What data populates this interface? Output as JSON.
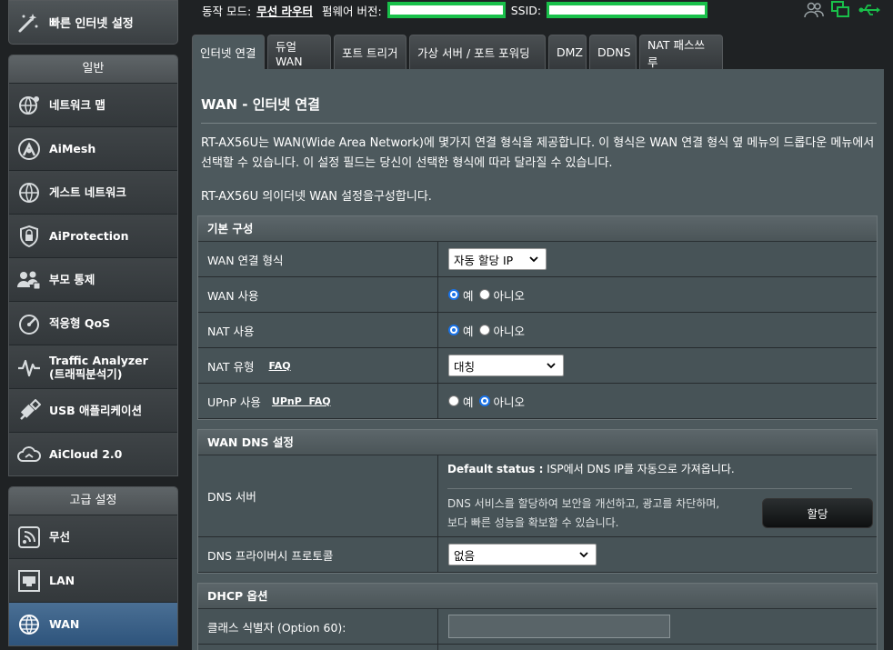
{
  "quick_setup": {
    "label": "빠른 인터넷 설정"
  },
  "sidebar": {
    "general_title": "일반",
    "general_items": [
      {
        "label": "네트워크 맵",
        "icon": "globe-network-icon"
      },
      {
        "label": "AiMesh",
        "icon": "aimesh-icon"
      },
      {
        "label": "게스트 네트워크",
        "icon": "guest-network-icon"
      },
      {
        "label": "AiProtection",
        "icon": "shield-icon"
      },
      {
        "label": "부모 통제",
        "icon": "parental-control-icon"
      },
      {
        "label": "적응형 QoS",
        "icon": "gauge-icon"
      },
      {
        "label": "Traffic Analyzer",
        "label2": "(트래픽분석기)",
        "icon": "pulse-icon"
      },
      {
        "label": "USB 애플리케이션",
        "icon": "usb-icon"
      },
      {
        "label": "AiCloud 2.0",
        "icon": "cloud-icon"
      }
    ],
    "advanced_title": "고급 설정",
    "advanced_items": [
      {
        "label": "무선",
        "icon": "wireless-icon"
      },
      {
        "label": "LAN",
        "icon": "lan-icon"
      },
      {
        "label": "WAN",
        "icon": "globe-icon",
        "active": true
      }
    ]
  },
  "topbar": {
    "mode_label": "동작 모드:",
    "mode_value": "무선 라우터",
    "firmware_label": "펌웨어 버전:",
    "ssid_label": "SSID:"
  },
  "tabs": [
    "인터넷 연결",
    "듀얼 WAN",
    "포트 트리거",
    "가상 서버 / 포트 포워딩",
    "DMZ",
    "DDNS",
    "NAT 패스쓰루"
  ],
  "main": {
    "title": "WAN - 인터넷 연결",
    "description": "RT-AX56U는 WAN(Wide Area Network)에 몇가지 연결 형식을 제공합니다. 이 형식은 WAN 연결 형식 옆 메뉴의 드롭다운 메뉴에서 선택할 수 있습니다. 이 설정 필드는 당신이 선택한 형식에 따라 달라질 수 있습니다.",
    "description2": "RT-AX56U 의이더넷 WAN 설정을구성합니다."
  },
  "basic": {
    "header": "기본 구성",
    "wan_type_label": "WAN 연결 형식",
    "wan_type_value": "자동 할당 IP",
    "wan_enable_label": "WAN 사용",
    "nat_enable_label": "NAT 사용",
    "nat_type_label": "NAT 유형",
    "nat_type_faq": "FAQ",
    "nat_type_value": "대칭",
    "upnp_label": "UPnP 사용",
    "upnp_faq": "UPnP  FAQ",
    "yes": "예",
    "no": "아니오"
  },
  "dns": {
    "header": "WAN DNS 설정",
    "server_label": "DNS 서버",
    "status_bold": "Default status :",
    "status_text": " ISP에서 DNS IP를 자동으로 가져옵니다.",
    "help_line1": "DNS 서비스를 할당하여 보안을 개선하고, 광고를 차단하며,",
    "help_line2": "보다 빠른 성능을 확보할 수 있습니다.",
    "assign_button": "할당",
    "privacy_label": "DNS 프라이버시 프로토콜",
    "privacy_value": "없음"
  },
  "dhcp": {
    "header": "DHCP 옵션",
    "class_id_label": "클래스 식별자 (Option 60):"
  }
}
